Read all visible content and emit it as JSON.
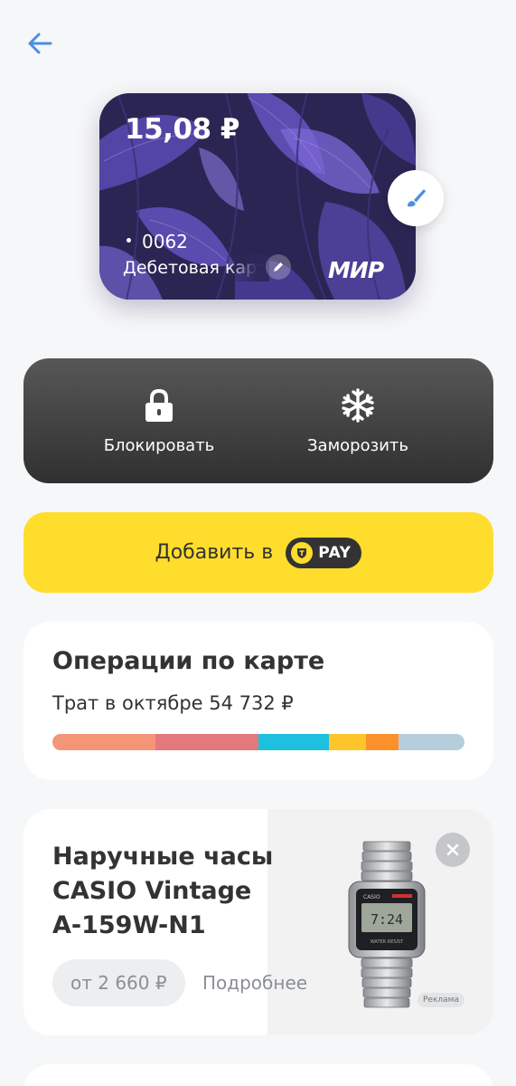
{
  "header": {
    "back_icon": "arrow-left-icon"
  },
  "card": {
    "balance": "15,08 ₽",
    "number": "0062",
    "type": "Дебетовая карта",
    "payment_system": "МИР",
    "rename_icon": "pencil-icon",
    "design_icon": "paint-brush-icon"
  },
  "actions": {
    "block_label": "Блокировать",
    "block_icon": "lock-icon",
    "freeze_label": "Заморозить",
    "freeze_icon": "snowflake-icon"
  },
  "tpay": {
    "label": "Добавить в",
    "logo_text": "PAY"
  },
  "operations": {
    "title": "Операции по карте",
    "subtitle": "Трат в октябре 54 732 ₽",
    "spend_segments": [
      {
        "color": "#f59577",
        "share": 0.25
      },
      {
        "color": "#e3787d",
        "share": 0.25
      },
      {
        "color": "#1ec0e0",
        "share": 0.17
      },
      {
        "color": "#fec52b",
        "share": 0.09
      },
      {
        "color": "#fc912c",
        "share": 0.08
      },
      {
        "color": "#b4cfdb",
        "share": 0.16
      }
    ]
  },
  "ad": {
    "title": "Наручные часы CASIO Vintage A-159W-N1",
    "price": "от 2 660 ₽",
    "more": "Подробнее",
    "label": "Реклама",
    "close_icon": "close-icon"
  },
  "colors": {
    "accent_yellow": "#ffdd2d",
    "link_blue": "#4b8fe2",
    "dark_panel": "#3a3a3a"
  }
}
